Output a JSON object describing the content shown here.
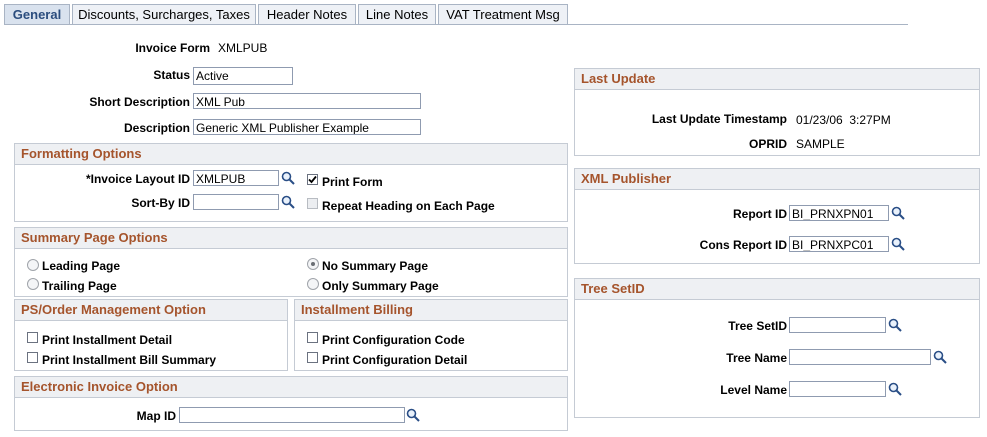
{
  "tabs": [
    {
      "label": "General"
    },
    {
      "label": "Discounts, Surcharges, Taxes"
    },
    {
      "label": "Header Notes"
    },
    {
      "label": "Line Notes"
    },
    {
      "label": "VAT Treatment Msg"
    }
  ],
  "invoice_form": {
    "label": "Invoice Form",
    "value": "XMLPUB"
  },
  "status": {
    "label": "Status",
    "value": "Active"
  },
  "short_description": {
    "label": "Short Description",
    "value": "XML Pub"
  },
  "description": {
    "label": "Description",
    "value": "Generic XML Publisher Example"
  },
  "formatting": {
    "title": "Formatting Options",
    "layout_label": "*Invoice Layout ID",
    "layout_value": "XMLPUB",
    "sortby_label": "Sort-By ID",
    "sortby_value": "",
    "print_form_label": "Print Form",
    "print_form_checked": true,
    "repeat_heading_label": "Repeat Heading on Each Page",
    "repeat_heading_checked": false
  },
  "summary": {
    "title": "Summary Page Options",
    "leading": "Leading Page",
    "trailing": "Trailing Page",
    "none": "No Summary Page",
    "only": "Only Summary Page",
    "selected": "none"
  },
  "ps_order": {
    "title": "PS/Order Management Option",
    "print_detail": "Print Installment Detail",
    "print_bill": "Print Installment Bill Summary"
  },
  "installment": {
    "title": "Installment Billing",
    "config_code": "Print Configuration Code",
    "config_detail": "Print Configuration Detail"
  },
  "electronic": {
    "title": "Electronic Invoice Option",
    "map_label": "Map ID",
    "map_value": ""
  },
  "last_update": {
    "title": "Last Update",
    "ts_label": "Last Update Timestamp",
    "ts_value": "01/23/06  3:27PM",
    "oprid_label": "OPRID",
    "oprid_value": "SAMPLE"
  },
  "xml_publisher": {
    "title": "XML Publisher",
    "report_label": "Report ID",
    "report_value": "BI_PRNXPN01",
    "cons_label": "Cons Report ID",
    "cons_value": "BI_PRNXPC01"
  },
  "tree": {
    "title": "Tree SetID",
    "setid_label": "Tree SetID",
    "setid_value": "",
    "name_label": "Tree Name",
    "name_value": "",
    "level_label": "Level Name",
    "level_value": ""
  },
  "colors": {
    "section_title": "#a5542c",
    "active_tab": "#2b4d7e"
  }
}
